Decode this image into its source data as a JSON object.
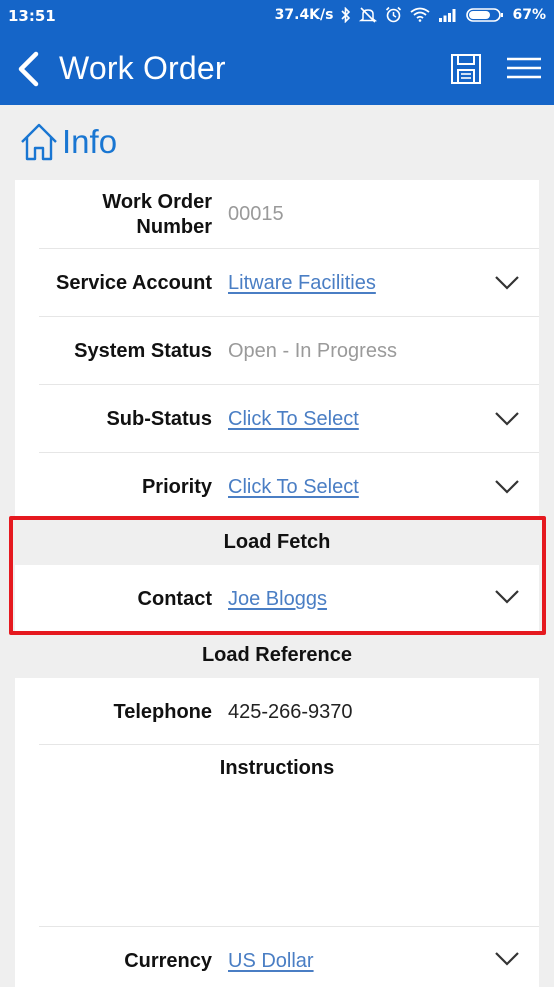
{
  "status_bar": {
    "time": "13:51",
    "net_speed": "37.4K/s",
    "battery_percent": "67%",
    "icons": [
      "bluetooth-icon",
      "mute-icon",
      "alarm-icon",
      "wifi-icon",
      "signal-icon",
      "battery-icon"
    ]
  },
  "app_bar": {
    "title": "Work Order",
    "icons": [
      "back-icon",
      "save-icon",
      "menu-icon"
    ]
  },
  "info": {
    "label": "Info",
    "icon": "home-icon"
  },
  "fields": {
    "work_order_number": {
      "label_line1": "Work Order",
      "label_line2": "Number",
      "value": "00015"
    },
    "service_account": {
      "label": "Service Account",
      "value": "Litware Facilities"
    },
    "system_status": {
      "label": "System Status",
      "value": "Open - In Progress"
    },
    "sub_status": {
      "label": "Sub-Status",
      "value": "Click To Select"
    },
    "priority": {
      "label": "Priority",
      "value": "Click To Select"
    },
    "load_fetch": {
      "title": "Load Fetch"
    },
    "contact": {
      "label": "Contact",
      "value": "Joe Bloggs"
    },
    "load_reference": {
      "title": "Load Reference"
    },
    "telephone": {
      "label": "Telephone",
      "value": "425-266-9370"
    },
    "instructions": {
      "title": "Instructions",
      "value": ""
    },
    "currency": {
      "label": "Currency",
      "value": "US Dollar"
    }
  },
  "colors": {
    "primary": "#1565c8",
    "link": "#4a7ec4",
    "highlight": "#e5191f",
    "background": "#efefef"
  }
}
